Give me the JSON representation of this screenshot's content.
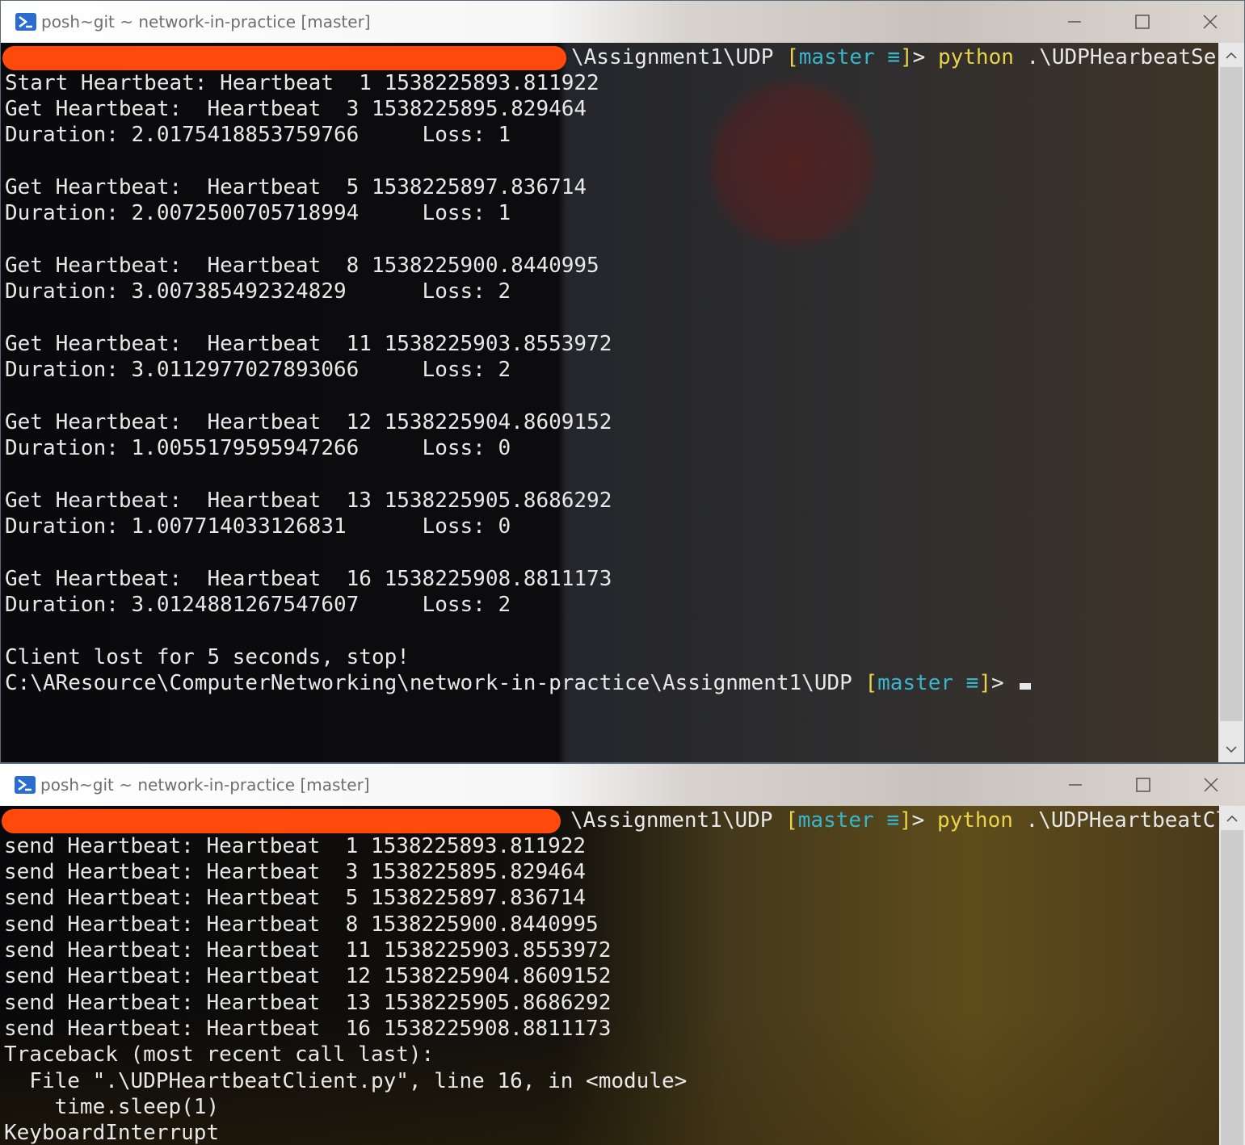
{
  "server_window": {
    "title": "posh~git ~ network-in-practice [master]",
    "prompt_suffix": "\\Assignment1\\UDP ",
    "branch_open": "[",
    "branch": "master",
    "branch_status": "≡",
    "branch_close": "]",
    "prompt_gt": "> ",
    "command": "python",
    "command_arg": " .\\UDPHearbeatServer.py",
    "output_lines": [
      "Start Heartbeat: Heartbeat  1 1538225893.811922",
      "Get Heartbeat:  Heartbeat  3 1538225895.829464",
      "Duration: 2.0175418853759766     Loss: 1",
      "",
      "Get Heartbeat:  Heartbeat  5 1538225897.836714",
      "Duration: 2.0072500705718994     Loss: 1",
      "",
      "Get Heartbeat:  Heartbeat  8 1538225900.8440995",
      "Duration: 3.007385492324829      Loss: 2",
      "",
      "Get Heartbeat:  Heartbeat  11 1538225903.8553972",
      "Duration: 3.0112977027893066     Loss: 2",
      "",
      "Get Heartbeat:  Heartbeat  12 1538225904.8609152",
      "Duration: 1.0055179595947266     Loss: 0",
      "",
      "Get Heartbeat:  Heartbeat  13 1538225905.8686292",
      "Duration: 1.007714033126831      Loss: 0",
      "",
      "Get Heartbeat:  Heartbeat  16 1538225908.8811173",
      "Duration: 3.0124881267547607     Loss: 2",
      "",
      "Client lost for 5 seconds, stop!"
    ],
    "final_prompt_path": "C:\\AResource\\ComputerNetworking\\network-in-practice\\Assignment1\\UDP "
  },
  "client_window": {
    "title": "posh~git ~ network-in-practice [master]",
    "prompt_suffix": "\\Assignment1\\UDP ",
    "branch_open": "[",
    "branch": "master",
    "branch_status": "≡",
    "branch_close": "]",
    "prompt_gt": "> ",
    "command": "python",
    "command_arg": " .\\UDPHeartbeatClient.py",
    "output_lines": [
      "send Heartbeat: Heartbeat  1 1538225893.811922",
      "send Heartbeat: Heartbeat  3 1538225895.829464",
      "send Heartbeat: Heartbeat  5 1538225897.836714",
      "send Heartbeat: Heartbeat  8 1538225900.8440995",
      "send Heartbeat: Heartbeat  11 1538225903.8553972",
      "send Heartbeat: Heartbeat  12 1538225904.8609152",
      "send Heartbeat: Heartbeat  13 1538225905.8686292",
      "send Heartbeat: Heartbeat  16 1538225908.8811173",
      "Traceback (most recent call last):",
      "  File \".\\UDPHeartbeatClient.py\", line 16, in <module>",
      "    time.sleep(1)",
      "KeyboardInterrupt"
    ]
  },
  "colors": {
    "prompt_yellow": "#e9d44a",
    "branch_cyan": "#39b6c9",
    "redaction_orange": "#ff4a0c",
    "powershell_blue": "#2b6cd1"
  },
  "icons": [
    "powershell-icon",
    "minimize-icon",
    "maximize-icon",
    "close-icon",
    "scroll-up-icon",
    "scroll-down-icon"
  ]
}
